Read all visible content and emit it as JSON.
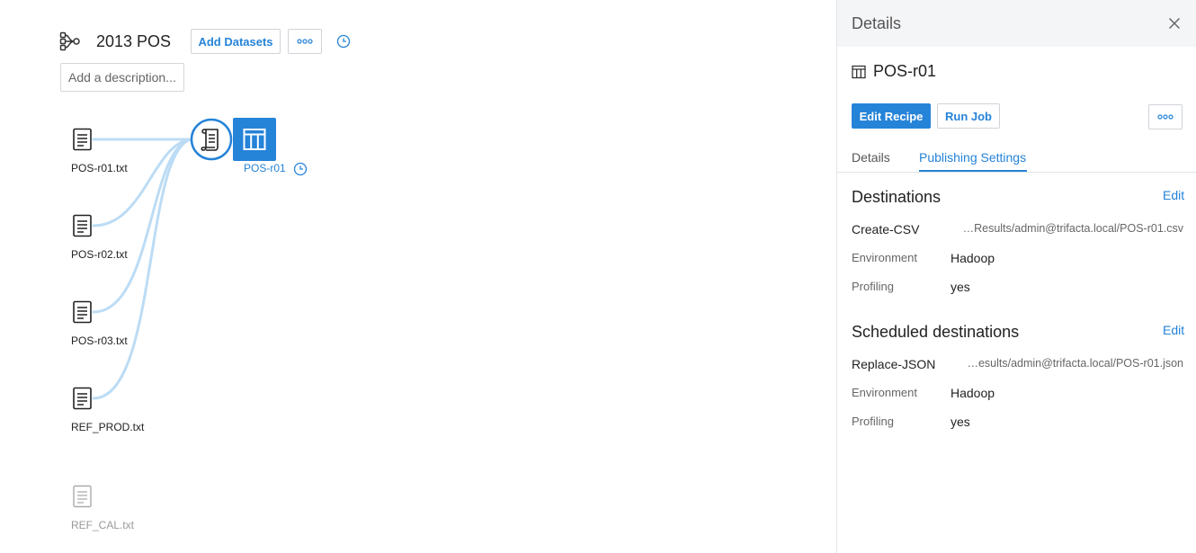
{
  "flow": {
    "title": "2013 POS",
    "add_datasets_label": "Add Datasets",
    "description_placeholder": "Add a description...",
    "datasets": [
      {
        "label": "POS-r01.txt",
        "disabled": false
      },
      {
        "label": "POS-r02.txt",
        "disabled": false
      },
      {
        "label": "POS-r03.txt",
        "disabled": false
      },
      {
        "label": "REF_PROD.txt",
        "disabled": false
      },
      {
        "label": "REF_CAL.txt",
        "disabled": true
      }
    ],
    "output_label": "POS-r01"
  },
  "panel": {
    "header_title": "Details",
    "name": "POS-r01",
    "edit_recipe_label": "Edit Recipe",
    "run_job_label": "Run Job",
    "tabs": [
      {
        "label": "Details",
        "active": false
      },
      {
        "label": "Publishing Settings",
        "active": true
      }
    ],
    "destinations": {
      "title": "Destinations",
      "edit_label": "Edit",
      "name": "Create-CSV",
      "path": "…Results/admin@trifacta.local/POS-r01.csv",
      "environment_label": "Environment",
      "environment_value": "Hadoop",
      "profiling_label": "Profiling",
      "profiling_value": "yes"
    },
    "scheduled": {
      "title": "Scheduled destinations",
      "edit_label": "Edit",
      "name": "Replace-JSON",
      "path": "…esults/admin@trifacta.local/POS-r01.json",
      "environment_label": "Environment",
      "environment_value": "Hadoop",
      "profiling_label": "Profiling",
      "profiling_value": "yes"
    }
  },
  "colors": {
    "accent": "#2583d8",
    "connector": "#bcdcf5",
    "disabled": "#999999"
  }
}
